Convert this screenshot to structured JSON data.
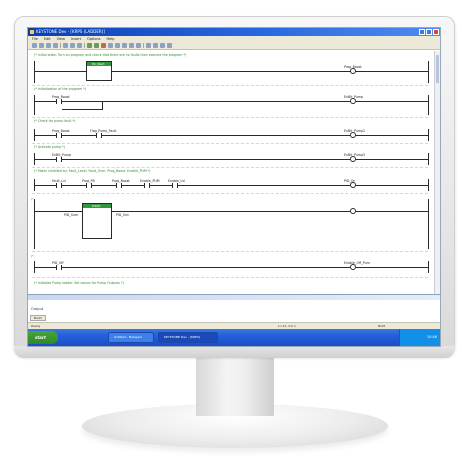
{
  "window": {
    "title": "KEYSTONE Dev - [KRPS (LADDER)]"
  },
  "menu": [
    "File",
    "Edit",
    "View",
    "Insert",
    "Options",
    "Help"
  ],
  "editor": {
    "rung1": {
      "comment": "(* Initial state: Turn on program and check that there are no faults then execute the program *)",
      "block_name": "Pb_Start",
      "coil": "Prog_Boost"
    },
    "rung2": {
      "comment": "(* Initialization of the program *)",
      "contact": "Prog_Boost",
      "coil": "EnBit_Pump"
    },
    "rung3": {
      "comment": "(* Check for pump fault *)",
      "contact1": "Prog_Boost",
      "contact2": "Flag_Pump_Fault",
      "coil": "EnBit_Pump2"
    },
    "rung4": {
      "comment": "(* Activate pump *)",
      "contact": "EnBit_Pump",
      "coil": "EnBit_Pump3"
    },
    "rung5": {
      "comment": "(* Motor inhibited by: Fault_Level, Fault_Over, Prog_Boost, Enable_PUM *)",
      "contacts": [
        "Fault_Lvl",
        "Prog_FB",
        "Prog_Boost",
        "Enable_PUM",
        "Enable_Lvl"
      ],
      "coil": "PID_On"
    },
    "rung6": {
      "block_name": "PIDAT",
      "in": "PID_Sum",
      "out": "PID_Out"
    },
    "rung7": {
      "contact": "PID_Off",
      "coil": "Enable_Off_Pum"
    },
    "rung8": {
      "comment": "(* Initialize Pump ladder. Set values for Pump Outputs *)"
    }
  },
  "output": {
    "header": "Output",
    "tab": "Build"
  },
  "status": {
    "left": "Ready",
    "mid": "Ln 21, Col 1",
    "right": "NUM"
  },
  "taskbar": {
    "start_label": "start",
    "items": [
      "Untitled - Notepad",
      "KEYSTONE Dev - [KRPS]"
    ],
    "clock": "10:46"
  }
}
